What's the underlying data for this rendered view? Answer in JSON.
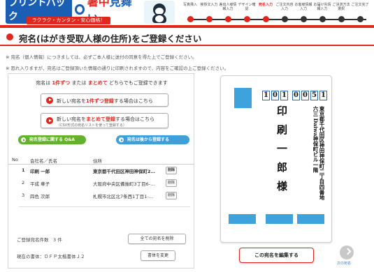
{
  "header": {
    "logo_text": "プリントパック",
    "logo_title_prefix": "暑中",
    "logo_title_suffix": "見舞い",
    "logo_sub": "ラクラク・カンタン・安心価格！",
    "steps": [
      {
        "label": "写真挿入",
        "state": "done"
      },
      {
        "label": "挨拶文入力",
        "state": "done"
      },
      {
        "label": "差出人様情報入力",
        "state": "done"
      },
      {
        "label": "デザイン確認",
        "state": "done"
      },
      {
        "label": "宛名入力",
        "state": "active"
      },
      {
        "label": "ご注文内容入力",
        "state": "future"
      },
      {
        "label": "お客様情報入力",
        "state": "future"
      },
      {
        "label": "お届け先情報入力",
        "state": "future"
      },
      {
        "label": "ご決済方法選択",
        "state": "future"
      },
      {
        "label": "ご注文完了",
        "state": "future"
      }
    ],
    "accent_color": "#e0261d"
  },
  "title": "宛名(はがき受取人様の住所)をご登録ください",
  "notes": [
    "※ 宛名（個人情報）につきましては、必ずご本人様に送付の同意を得た上でご登録ください。",
    "※ 恐れ入りますが、宛名はご登録頂いた情報の通りに印刷されますので、内容をご確認の上ご登録ください。"
  ],
  "panel": {
    "caption_prefix": "宛名は",
    "caption_one": "1件ずつ",
    "caption_mid": "または",
    "caption_bulk": "まとめて",
    "caption_suffix": "どちらでもご登録できます",
    "btn_single_prefix": "新しい宛名を",
    "btn_single_red": "1件ずつ登録",
    "btn_single_suffix": "する場合はこちら",
    "btn_bulk_prefix": "新しい宛名を",
    "btn_bulk_red": "まとめて登録",
    "btn_bulk_suffix": "する場合はこちら",
    "btn_bulk_sub": "（CSV形式の宛名リストを使って登録する）",
    "qa_label": "宛名登録に関する Q&A",
    "help_label": "宛名は後から登録する",
    "table_headers": [
      "No",
      "会社名／氏名",
      "住所"
    ],
    "rows": [
      {
        "no": "1",
        "name": "印刷 一郎",
        "address": "東京都千代田区神田神保町2…",
        "delete": "削除"
      },
      {
        "no": "2",
        "name": "平成 華子",
        "address": "大阪府中央区備後町3丁目6-…",
        "delete": "削除"
      },
      {
        "no": "3",
        "name": "四色 次郎",
        "address": "札幌市北区北7条西1丁目1-…",
        "delete": "削除"
      }
    ],
    "count_text": "ご登録宛名件数　3 件",
    "delete_all": "全ての宛名を削除",
    "font_text": "現在の書体：ＤＦＰ太楷書体Ｊ２",
    "change_font": "書体を変更"
  },
  "postcard": {
    "zip": [
      "1",
      "0",
      "1",
      "0",
      "0",
      "5",
      "1"
    ],
    "name": "印刷一郎様",
    "address": "東京都千代田区神田神保町二丁目四番地六三 Daiwa神保町ビル一階",
    "stamp_color": "#3ea3dc"
  },
  "actions": {
    "edit_button": "この宛名を編集する",
    "next_label": "次の宛名"
  }
}
